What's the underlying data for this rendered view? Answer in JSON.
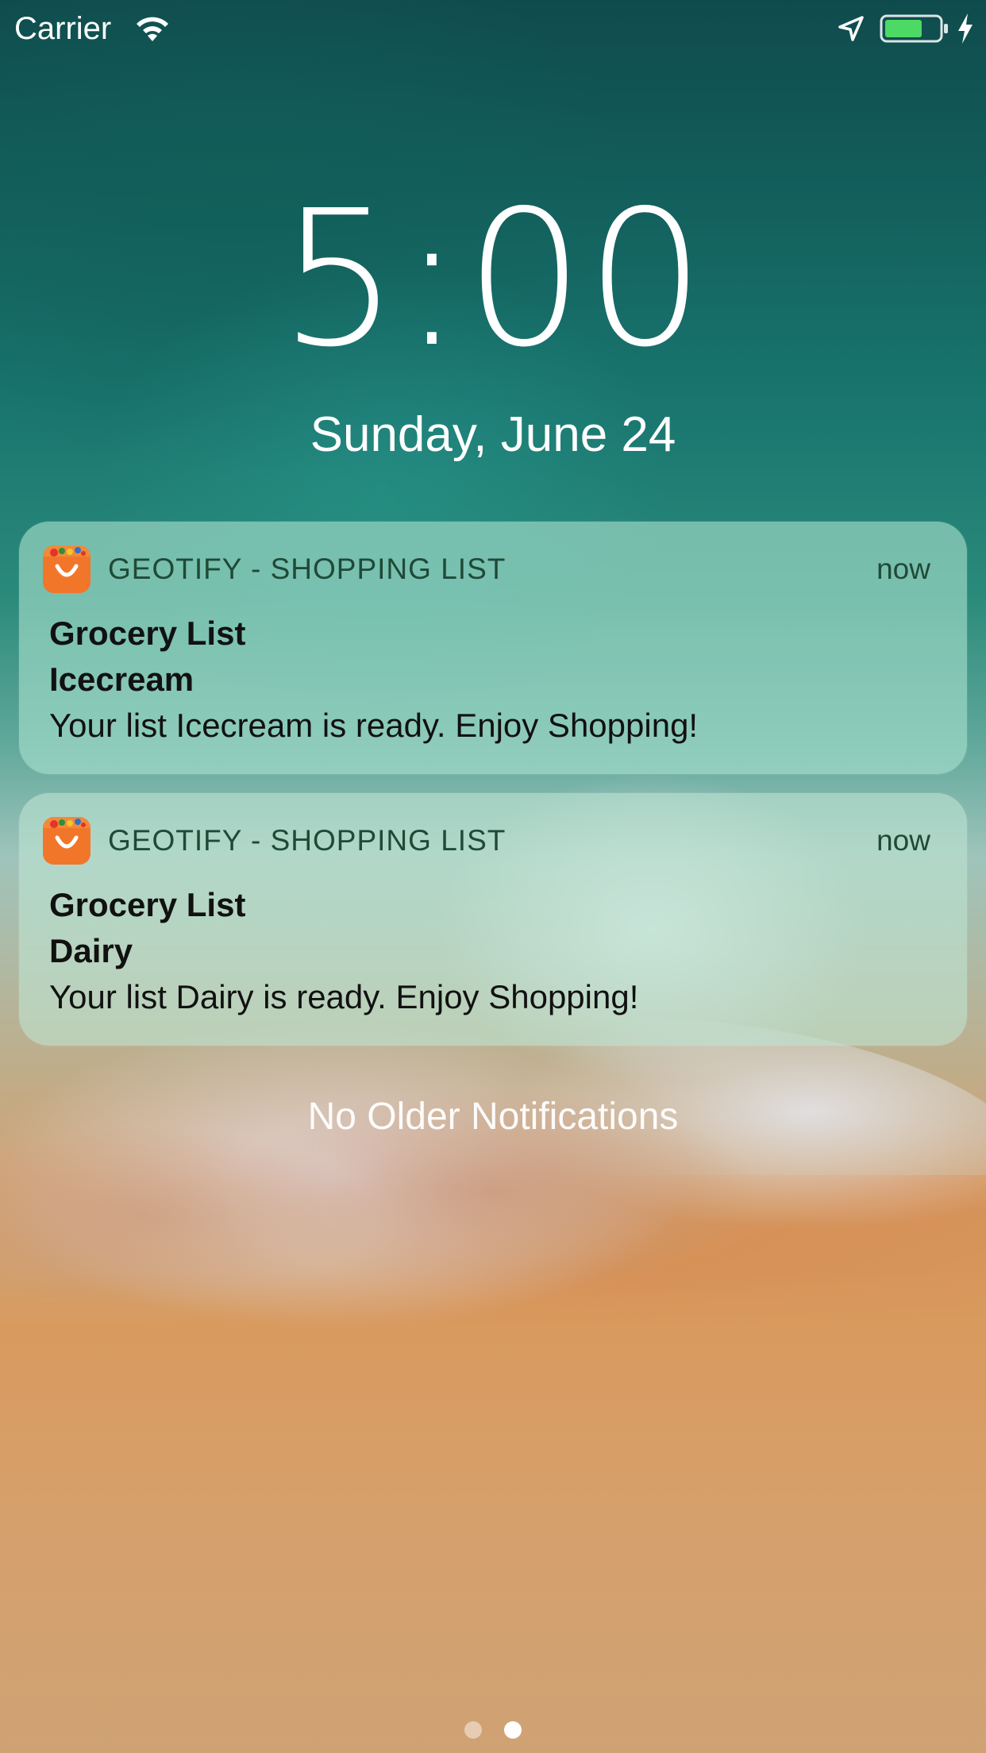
{
  "status_bar": {
    "carrier": "Carrier",
    "icons": [
      "wifi-icon",
      "location-icon",
      "battery-icon",
      "charging-icon"
    ],
    "battery_level": 0.6,
    "battery_color": "#4cd964"
  },
  "lock_screen": {
    "time": "5:00",
    "date": "Sunday, June 24"
  },
  "notifications": [
    {
      "app_icon": "shopping-bag-icon",
      "app_name": "GEOTIFY - SHOPPING LIST",
      "time": "now",
      "title": "Grocery List",
      "subtitle": "Icecream",
      "body": "Your list Icecream is ready. Enjoy Shopping!"
    },
    {
      "app_icon": "shopping-bag-icon",
      "app_name": "GEOTIFY - SHOPPING LIST",
      "time": "now",
      "title": "Grocery List",
      "subtitle": "Dairy",
      "body": "Your list Dairy is ready. Enjoy Shopping!"
    }
  ],
  "footer": {
    "no_older_text": "No Older Notifications",
    "page_count": 2,
    "current_page": 2
  },
  "colors": {
    "app_icon_bg": "#f2762a",
    "app_name_text": "#1f4a36"
  }
}
